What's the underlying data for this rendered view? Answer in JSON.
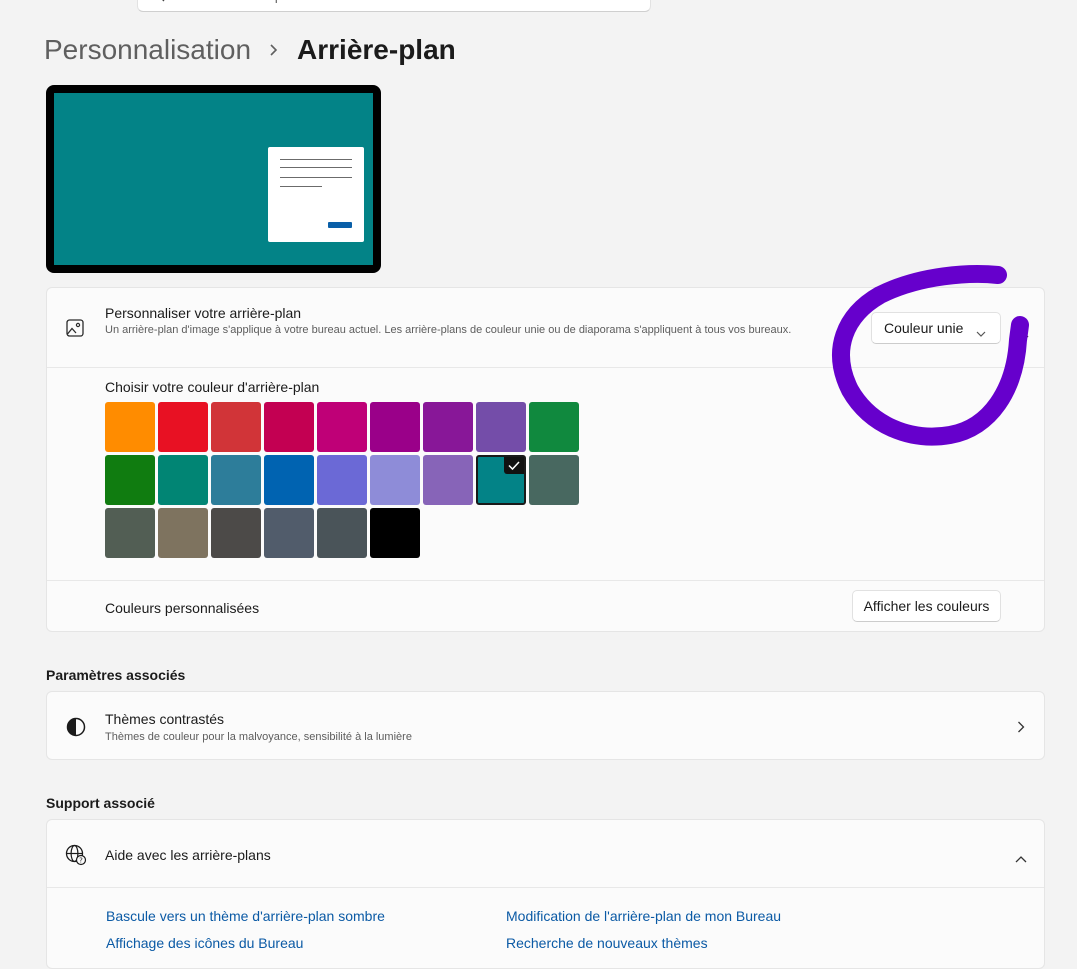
{
  "search": {
    "placeholder": "Rechercher un paramètre"
  },
  "breadcrumb": {
    "parent": "Personnalisation",
    "current": "Arrière-plan"
  },
  "personalize": {
    "title": "Personnaliser votre arrière-plan",
    "description": "Un arrière-plan d'image s'applique à votre bureau actuel. Les arrière-plans de couleur unie ou de diaporama s'appliquent à tous vos bureaux.",
    "dropdown_value": "Couleur unie"
  },
  "colors": {
    "heading": "Choisir votre couleur d'arrière-plan",
    "swatches": [
      "#ff8c00",
      "#e81123",
      "#d13438",
      "#c30052",
      "#bf0077",
      "#9a0089",
      "#881798",
      "#744da9",
      "#10893e",
      "#107c10",
      "#018574",
      "#2d7d9a",
      "#0063b1",
      "#6b69d6",
      "#8e8cd8",
      "#8764b8",
      "#038387",
      "#486860",
      "#525e54",
      "#7e735f",
      "#4c4a48",
      "#515c6b",
      "#4a5459",
      "#000000"
    ],
    "selected_index": 16
  },
  "custom_colors": {
    "label": "Couleurs personnalisées",
    "button": "Afficher les couleurs"
  },
  "related": {
    "heading": "Paramètres associés",
    "item_title": "Thèmes contrastés",
    "item_desc": "Thèmes de couleur pour la malvoyance, sensibilité à la lumière"
  },
  "support": {
    "heading": "Support associé",
    "item_title": "Aide avec les arrière-plans",
    "links": [
      "Bascule vers un thème d'arrière-plan sombre",
      "Modification de l'arrière-plan de mon Bureau",
      "Affichage des icônes du Bureau",
      "Recherche de nouveaux thèmes"
    ]
  },
  "accent": {
    "link": "#0b5aa5",
    "annotation": "#6600cc",
    "preview_bg": "#038387"
  }
}
